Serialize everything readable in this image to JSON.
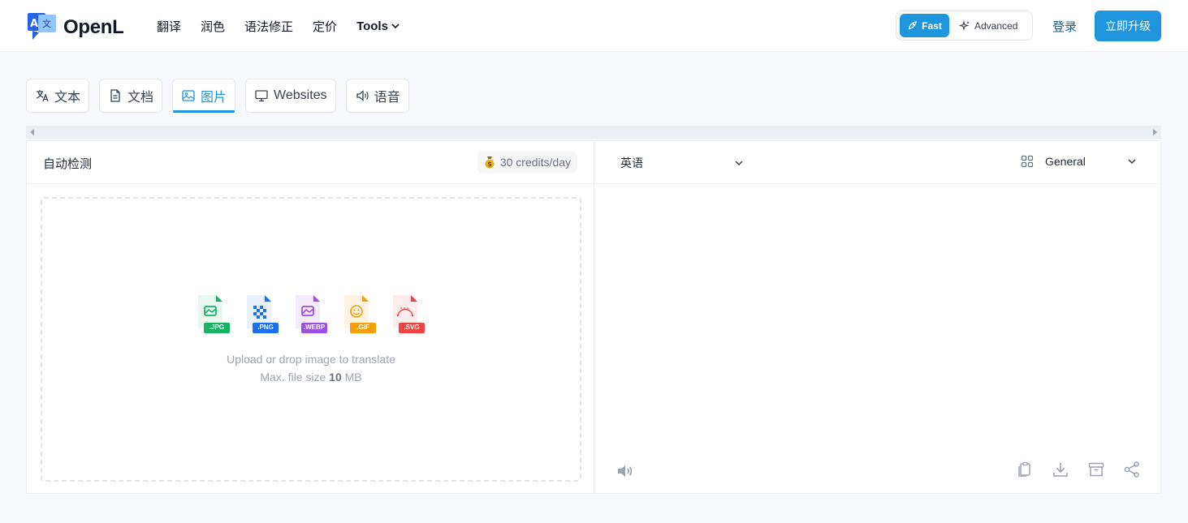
{
  "header": {
    "logo_text": "OpenL",
    "nav": [
      {
        "label": "翻译"
      },
      {
        "label": "润色"
      },
      {
        "label": "语法修正"
      },
      {
        "label": "定价"
      },
      {
        "label": "Tools"
      }
    ],
    "mode_fast": "Fast",
    "mode_advanced": "Advanced",
    "login": "登录",
    "upgrade": "立即升级"
  },
  "tabs": [
    {
      "label": "文本",
      "icon": "translate-icon"
    },
    {
      "label": "文档",
      "icon": "document-icon"
    },
    {
      "label": "图片",
      "icon": "image-icon",
      "active": true
    },
    {
      "label": "Websites",
      "icon": "monitor-icon"
    },
    {
      "label": "语音",
      "icon": "speaker-icon"
    }
  ],
  "source": {
    "language": "自动检测",
    "credits": "30 credits/day"
  },
  "upload": {
    "filetypes": [
      ".JPG",
      ".PNG",
      ".WEBP",
      ".GIF",
      ".SVG"
    ],
    "message": "Upload or drop image to translate",
    "size_prefix": "Max. file size",
    "size_value": "10",
    "size_unit": "MB"
  },
  "target": {
    "language": "英语",
    "domain": "General"
  },
  "colors": {
    "accent": "#1f95dd",
    "jpg": "#16b364",
    "png": "#1b6ff2",
    "webp": "#9b4fe6",
    "gif": "#f59e0b",
    "svg": "#ef4444"
  }
}
